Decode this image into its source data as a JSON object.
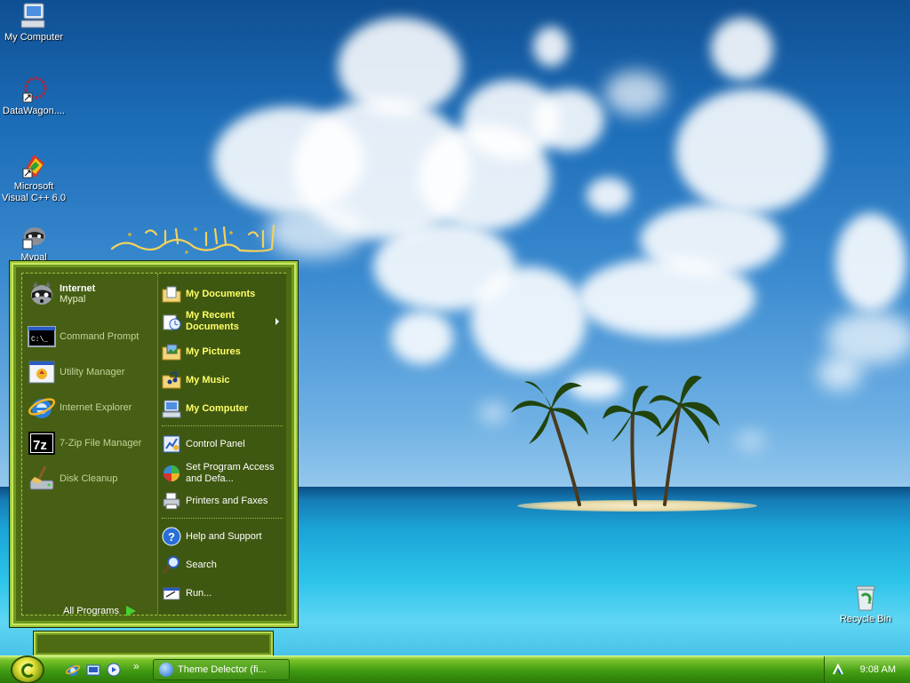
{
  "desktop": {
    "icons": [
      {
        "label": "My Computer"
      },
      {
        "label": "DataWagon...."
      },
      {
        "label": "Microsoft Visual C++ 6.0"
      },
      {
        "label": "Mypal"
      },
      {
        "label": "Recycle Bin"
      }
    ]
  },
  "start_menu": {
    "pinned": [
      {
        "title": "Internet",
        "subtitle": "Mypal",
        "icon": "raccoon-icon"
      }
    ],
    "recent": [
      {
        "label": "Command Prompt",
        "icon": "cmd-icon"
      },
      {
        "label": "Utility Manager",
        "icon": "utility-manager-icon"
      },
      {
        "label": "Internet Explorer",
        "icon": "ie-icon"
      },
      {
        "label": "7-Zip File Manager",
        "icon": "7zip-icon"
      },
      {
        "label": "Disk Cleanup",
        "icon": "disk-cleanup-icon"
      }
    ],
    "all_programs": "All Programs",
    "right": {
      "my_documents": "My Documents",
      "my_recent_documents": "My Recent Documents",
      "my_pictures": "My Pictures",
      "my_music": "My Music",
      "my_computer": "My Computer",
      "control_panel": "Control Panel",
      "set_program_access": "Set Program Access and Defa...",
      "printers": "Printers and Faxes",
      "help": "Help and Support",
      "search": "Search",
      "run": "Run..."
    }
  },
  "taskbar": {
    "quick_launch_more": "»",
    "task": "Theme Delector (fi...",
    "clock": "9:08 AM"
  },
  "colors": {
    "menu_green": "#4d6b12",
    "taskbar_green": "#3f9a12",
    "bold_yellow": "#ffff66"
  }
}
